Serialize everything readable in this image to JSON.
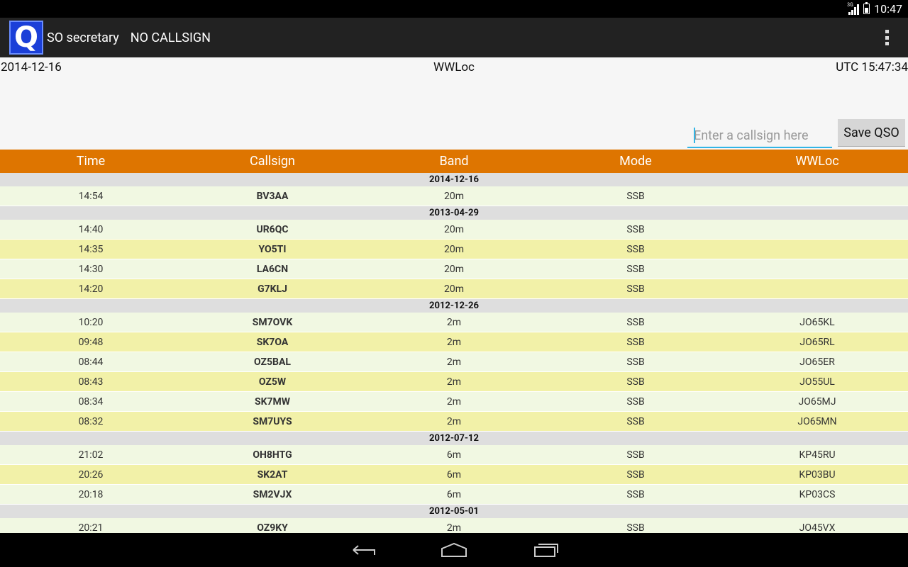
{
  "status_bar": {
    "time": "10:47",
    "network": "3G"
  },
  "app": {
    "title": "SO secretary",
    "subtitle": "NO CALLSIGN",
    "logo_letter": "Q"
  },
  "info": {
    "date": "2014-12-16",
    "center": "WWLoc",
    "utc": "UTC 15:47:34"
  },
  "entry": {
    "placeholder": "Enter a callsign here",
    "save_label": "Save QSO"
  },
  "columns": [
    "Time",
    "Callsign",
    "Band",
    "Mode",
    "WWLoc"
  ],
  "groups": [
    {
      "date": "2014-12-16",
      "rows": [
        [
          "14:54",
          "BV3AA",
          "20m",
          "SSB",
          ""
        ]
      ]
    },
    {
      "date": "2013-04-29",
      "rows": [
        [
          "14:40",
          "UR6QC",
          "20m",
          "SSB",
          ""
        ],
        [
          "14:35",
          "YO5TI",
          "20m",
          "SSB",
          ""
        ],
        [
          "14:30",
          "LA6CN",
          "20m",
          "SSB",
          ""
        ],
        [
          "14:20",
          "G7KLJ",
          "20m",
          "SSB",
          ""
        ]
      ]
    },
    {
      "date": "2012-12-26",
      "rows": [
        [
          "10:20",
          "SM7OVK",
          "2m",
          "SSB",
          "JO65KL"
        ],
        [
          "09:48",
          "SK7OA",
          "2m",
          "SSB",
          "JO65RL"
        ],
        [
          "08:44",
          "OZ5BAL",
          "2m",
          "SSB",
          "JO65ER"
        ],
        [
          "08:43",
          "OZ5W",
          "2m",
          "SSB",
          "JO55UL"
        ],
        [
          "08:34",
          "SK7MW",
          "2m",
          "SSB",
          "JO65MJ"
        ],
        [
          "08:32",
          "SM7UYS",
          "2m",
          "SSB",
          "JO65MN"
        ]
      ]
    },
    {
      "date": "2012-07-12",
      "rows": [
        [
          "21:02",
          "OH8HTG",
          "6m",
          "SSB",
          "KP45RU"
        ],
        [
          "20:26",
          "SK2AT",
          "6m",
          "SSB",
          "KP03BU"
        ],
        [
          "20:18",
          "SM2VJX",
          "6m",
          "SSB",
          "KP03CS"
        ]
      ]
    },
    {
      "date": "2012-05-01",
      "rows": [
        [
          "20:21",
          "OZ9KY",
          "2m",
          "SSB",
          "JO45VX"
        ]
      ]
    }
  ],
  "nav": {
    "back": "back-icon",
    "home": "home-icon",
    "recents": "recents-icon"
  }
}
